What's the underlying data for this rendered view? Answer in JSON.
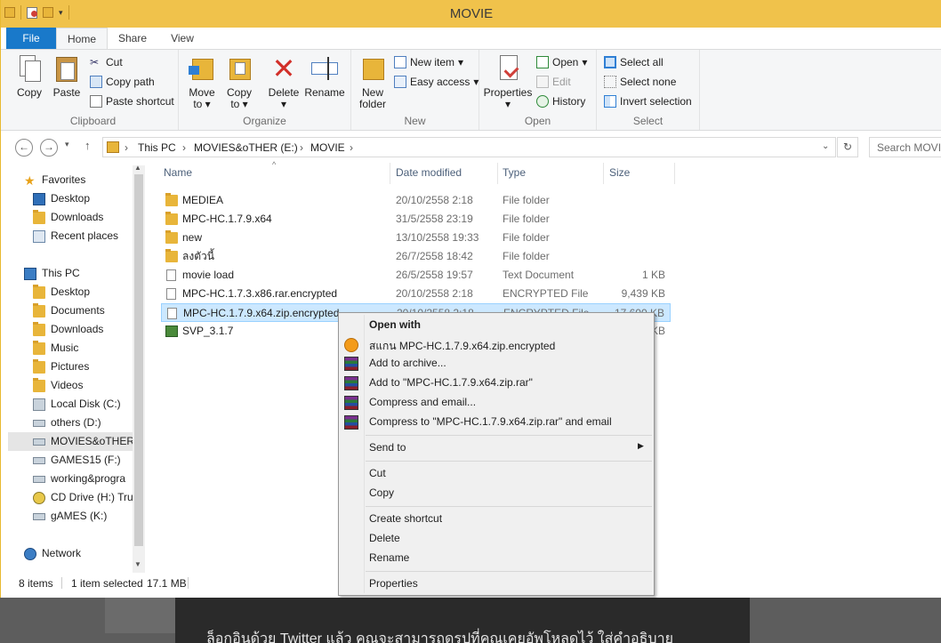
{
  "window": {
    "title": "MOVIE"
  },
  "ribbon_tabs": [
    "File",
    "Home",
    "Share",
    "View"
  ],
  "ribbon": {
    "clipboard": {
      "label": "Clipboard",
      "copy": "Copy",
      "paste": "Paste",
      "cut": "Cut",
      "copy_path": "Copy path",
      "paste_shortcut": "Paste shortcut"
    },
    "organize": {
      "label": "Organize",
      "move_to": "Move",
      "move_to2": "to",
      "copy_to": "Copy",
      "copy_to2": "to",
      "delete": "Delete",
      "rename": "Rename"
    },
    "new": {
      "label": "New",
      "new_folder": "New",
      "new_folder2": "folder",
      "new_item": "New item",
      "easy_access": "Easy access"
    },
    "open": {
      "label": "Open",
      "properties": "Properties",
      "open": "Open",
      "edit": "Edit",
      "history": "History"
    },
    "select": {
      "label": "Select",
      "select_all": "Select all",
      "select_none": "Select none",
      "invert": "Invert selection"
    }
  },
  "address": {
    "crumbs": [
      "This PC",
      "MOVIES&oTHER (E:)",
      "MOVIE"
    ],
    "search_placeholder": "Search MOVIE"
  },
  "nav": {
    "favorites": "Favorites",
    "fav_items": [
      "Desktop",
      "Downloads",
      "Recent places"
    ],
    "this_pc": "This PC",
    "pc_items": [
      "Desktop",
      "Documents",
      "Downloads",
      "Music",
      "Pictures",
      "Videos",
      "Local Disk (C:)",
      "others (D:)",
      "MOVIES&oTHER",
      "GAMES15 (F:)",
      "working&progra",
      "CD Drive (H:) Tru",
      "gAMES (K:)"
    ],
    "network": "Network"
  },
  "columns": {
    "name": "Name",
    "date": "Date modified",
    "type": "Type",
    "size": "Size"
  },
  "files": [
    {
      "name": "MEDIEA",
      "date": "20/10/2558 2:18",
      "type": "File folder",
      "size": "",
      "icon": "folder-icon"
    },
    {
      "name": "MPC-HC.1.7.9.x64",
      "date": "31/5/2558 23:19",
      "type": "File folder",
      "size": "",
      "icon": "folder-icon"
    },
    {
      "name": "new",
      "date": "13/10/2558 19:33",
      "type": "File folder",
      "size": "",
      "icon": "folder-icon"
    },
    {
      "name": "ลงตัวนี้",
      "date": "26/7/2558 18:42",
      "type": "File folder",
      "size": "",
      "icon": "folder-icon"
    },
    {
      "name": "movie load",
      "date": "26/5/2558 19:57",
      "type": "Text Document",
      "size": "1 KB",
      "icon": "document-icon"
    },
    {
      "name": "MPC-HC.1.7.3.x86.rar.encrypted",
      "date": "20/10/2558 2:18",
      "type": "ENCRYPTED File",
      "size": "9,439 KB",
      "icon": "document-icon"
    },
    {
      "name": "MPC-HC.1.7.9.x64.zip.encrypted",
      "date": "20/10/2558 2:18",
      "type": "ENCRYPTED File",
      "size": "17,600 KB",
      "icon": "document-icon"
    },
    {
      "name": "SVP_3.1.7",
      "date": "",
      "type": "",
      "size": "KB",
      "icon": "installer-icon"
    }
  ],
  "status": {
    "items": "8 items",
    "selected": "1 item selected",
    "size": "17.1 MB"
  },
  "context_menu": {
    "open_with": "Open with",
    "scan": "สแกน MPC-HC.1.7.9.x64.zip.encrypted",
    "add_archive": "Add to archive...",
    "add_rar": "Add to \"MPC-HC.1.7.9.x64.zip.rar\"",
    "compress_email": "Compress and email...",
    "compress_rar_email": "Compress to \"MPC-HC.1.7.9.x64.zip.rar\" and email",
    "send_to": "Send to",
    "cut": "Cut",
    "copy": "Copy",
    "create_shortcut": "Create shortcut",
    "delete": "Delete",
    "rename": "Rename",
    "properties": "Properties"
  },
  "background_text": "ล็อกอินด้วย Twitter แล้ว คุณจะสามารถดูรูปที่คุณเคยอัพโหลดไว้ ใส่คำอธิบาย"
}
